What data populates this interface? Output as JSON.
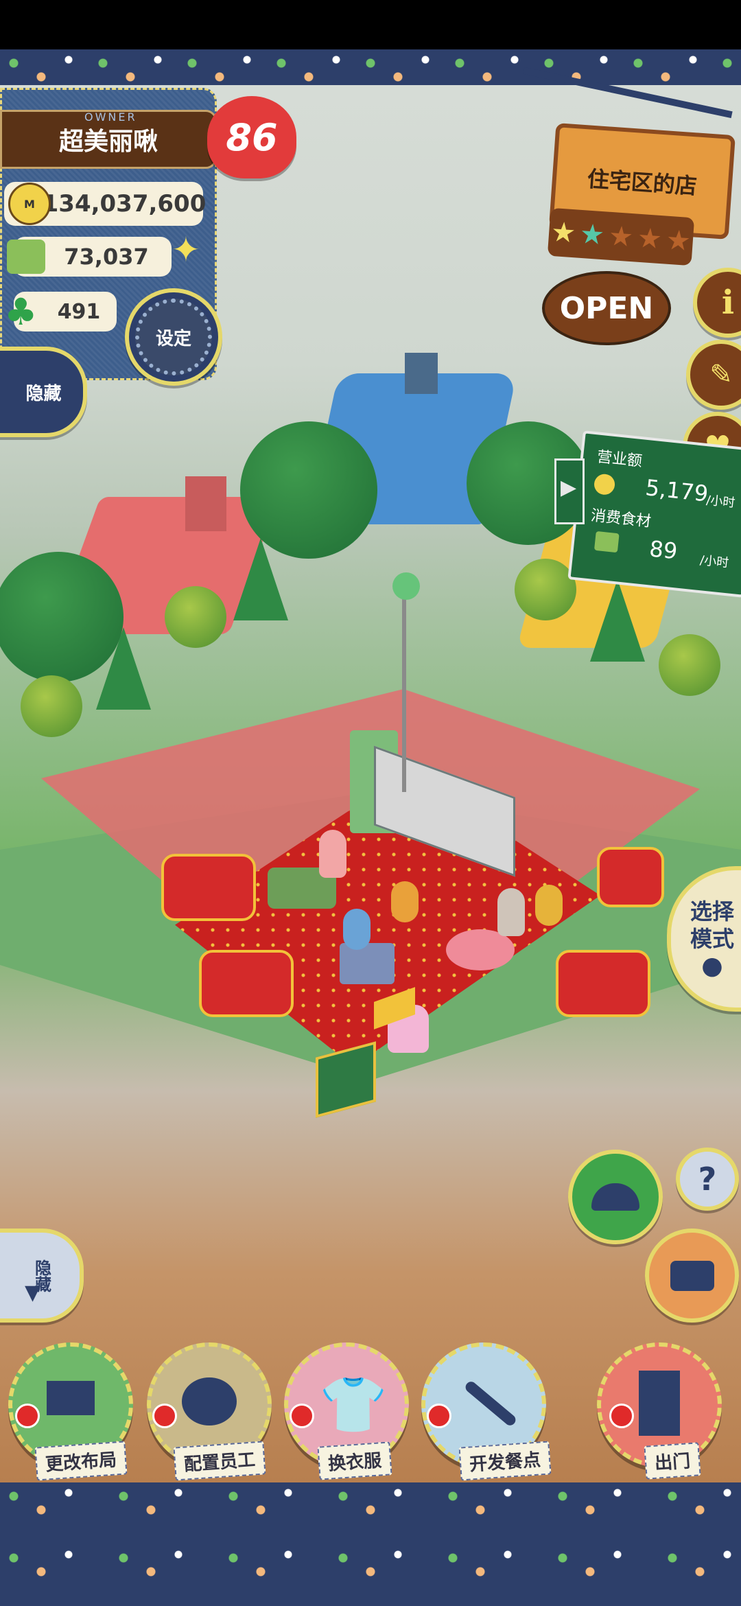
{
  "owner": {
    "tag": "OWNER",
    "name": "超美丽啾",
    "level": "86"
  },
  "stats": {
    "money": "134,037,600",
    "ingredients": "73,037",
    "clover": "491",
    "settings_label": "设定"
  },
  "hide_top_label": "隐藏",
  "shop_sign": {
    "name": "住宅区的店",
    "stars_filled": 2,
    "stars_total": 5,
    "status": "OPEN"
  },
  "side_buttons": {
    "info_icon": "info-icon",
    "recipe_icon": "book-icon",
    "heart_icon": "heart-icon"
  },
  "sales_board": {
    "revenue_label": "营业额",
    "revenue_value": "5,179",
    "revenue_unit": "/小时",
    "consume_label": "消费食材",
    "consume_value": "89",
    "consume_unit": "/小时"
  },
  "mode_button": {
    "label_line1": "选择",
    "label_line2": "模式"
  },
  "hide_bottom_label": "隐藏",
  "bottom_menu": [
    {
      "label": "更改布局",
      "icon": "table-icon",
      "color": "#6fb86a"
    },
    {
      "label": "配置员工",
      "icon": "bear-head-icon",
      "color": "#c9b98a"
    },
    {
      "label": "换衣服",
      "icon": "shirt-icon",
      "color": "#e9a9b9"
    },
    {
      "label": "开发餐点",
      "icon": "knife-icon",
      "color": "#b9d6e6"
    },
    {
      "label": "出门",
      "icon": "door-icon",
      "color": "#e97a6d"
    }
  ],
  "colors": {
    "denim": "#3d5e8c",
    "accent_yellow": "#e5d86a",
    "board_green": "#1f6b3c",
    "heart_red": "#e23b3b"
  }
}
